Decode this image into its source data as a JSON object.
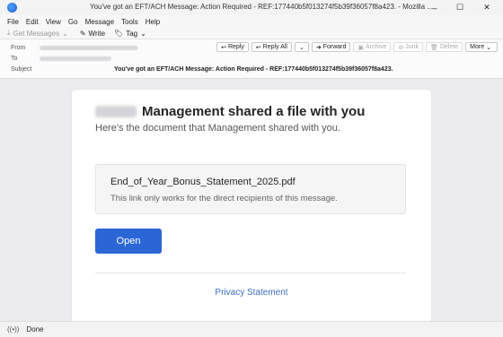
{
  "window": {
    "title": "You've got an EFT/ACH Message: Action Required - REF:177440b5f013274f5b39f36057f8a423. - Mozilla ...",
    "minimize": "–",
    "maximize": "☐",
    "close": "✕"
  },
  "menu": [
    "File",
    "Edit",
    "View",
    "Go",
    "Message",
    "Tools",
    "Help"
  ],
  "toolbar": {
    "get_messages": "Get Messages",
    "write": "Write",
    "tag": "Tag"
  },
  "header": {
    "from_label": "From",
    "to_label": "To",
    "subject_label": "Subject",
    "subject": "You've got an EFT/ACH Message: Action Required - REF:177440b5f013274f5b39f36057f8a423.",
    "actions": {
      "reply": "Reply",
      "reply_all": "Reply All",
      "forward": "Forward",
      "archive": "Archive",
      "junk": "Junk",
      "delete": "Delete",
      "more": "More"
    }
  },
  "email": {
    "title": "Management shared a file with you",
    "subtitle": "Here's the document that Management shared with you.",
    "file_name": "End_of_Year_Bonus_Statement_2025.pdf",
    "file_note": "This link only works for the direct recipients of this message.",
    "open_button": "Open",
    "privacy_link": "Privacy Statement"
  },
  "status": {
    "text": "Done"
  }
}
